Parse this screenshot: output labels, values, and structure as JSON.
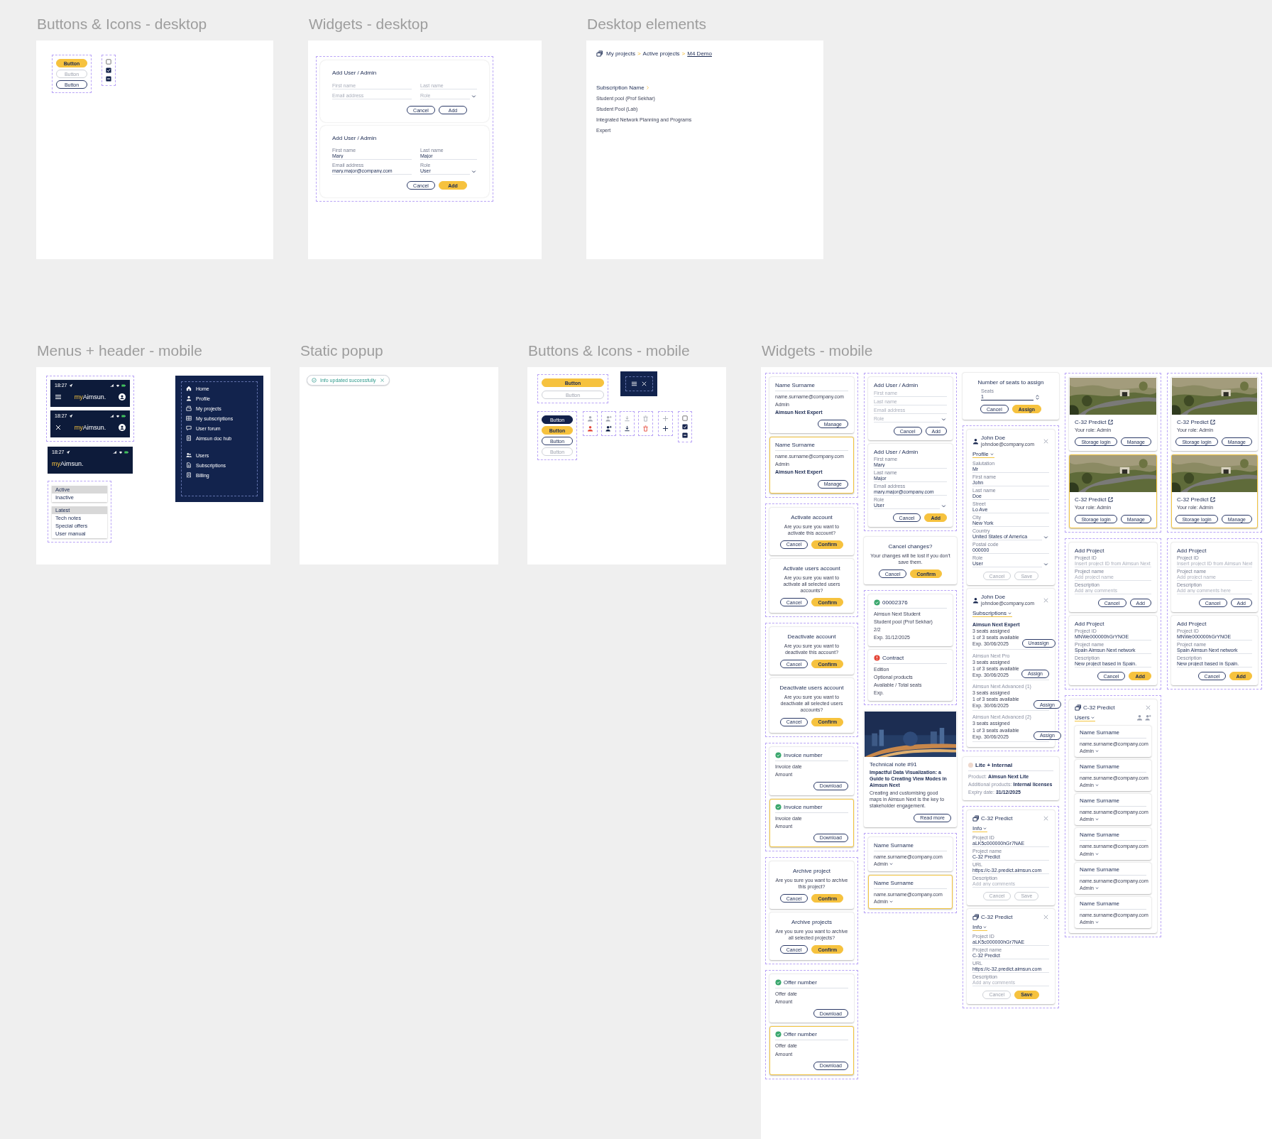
{
  "frames": [
    {
      "title": "Buttons & Icons - desktop",
      "groups": [
        {
          "kind": "buttons",
          "outlined": true,
          "items": [
            {
              "label": "Button",
              "kind": "primary"
            },
            {
              "label": "Button",
              "kind": "disabled"
            },
            {
              "label": "Button",
              "kind": "outline"
            }
          ]
        },
        {
          "kind": "checkboxes",
          "outlined": true,
          "items": [
            {
              "checked": false,
              "mixed": false
            },
            {
              "checked": true,
              "mixed": false
            },
            {
              "checked": true,
              "mixed": true
            }
          ]
        }
      ]
    },
    {
      "title": "Widgets - desktop",
      "groups": [
        {
          "kind": "cards",
          "outlined": true,
          "cards": [
            {
              "kind": "form",
              "title": "Add User / Admin",
              "fields": [
                {
                  "placeholder": "First name"
                },
                {
                  "placeholder": "Last name"
                },
                {
                  "placeholder": "Email address"
                },
                {
                  "placeholder": "Role",
                  "dropdown": true
                }
              ],
              "buttons": [
                {
                  "label": "Cancel",
                  "kind": "outline"
                },
                {
                  "label": "Add",
                  "kind": "outline"
                }
              ]
            },
            {
              "kind": "form",
              "title": "Add User / Admin",
              "fields": [
                {
                  "label": "First name",
                  "value": "Mary"
                },
                {
                  "label": "Last name",
                  "value": "Major"
                },
                {
                  "label": "Email address",
                  "value": "mary.major@company.com"
                },
                {
                  "label": "Role",
                  "value": "User",
                  "dropdown": true
                }
              ],
              "buttons": [
                {
                  "label": "Cancel",
                  "kind": "outline"
                },
                {
                  "label": "Add",
                  "kind": "primary"
                }
              ]
            }
          ]
        }
      ]
    },
    {
      "title": "Desktop elements",
      "groups": [
        {
          "kind": "breadcrumb",
          "items": [
            {
              "label": "My projects",
              "current": false
            },
            {
              "label": "Active projects",
              "current": false
            },
            {
              "label": "M4 Demo",
              "current": true
            }
          ],
          "separators": [
            ">",
            ">"
          ]
        },
        {
          "kind": "sub-list",
          "title": "Subscription Name",
          "items": [
            "Student pool (Prof Sekhar)",
            "Student Pool (Lab)",
            "Integrated Network Planning and Programs",
            "Expert"
          ]
        }
      ]
    },
    {
      "title": "Menus + header - mobile",
      "groups": [
        {
          "kind": "headers",
          "outlined": true,
          "headers": [
            {
              "time": "18:27",
              "logo_prefix": "my",
              "logo_name": "Aimsun."
            },
            {
              "time": "18:27",
              "logo_prefix": "my",
              "logo_name": "Aimsun."
            }
          ]
        },
        {
          "kind": "headers",
          "outlined": false,
          "headers": [
            {
              "time": "18:27",
              "logo_prefix": "my",
              "logo_name": "Aimsun."
            }
          ]
        },
        {
          "kind": "side-menu",
          "sections": [
            {
              "items": [
                "Home",
                "Profile",
                "My projects",
                "My subscriptions",
                "User forum",
                "Aimsun doc hub"
              ]
            },
            {
              "items": [
                "Users",
                "Subscriptions",
                "Billing"
              ]
            }
          ]
        },
        {
          "kind": "list-menu",
          "outlined": true,
          "sections": [
            {
              "items": [
                {
                  "label": "Active",
                  "selected": true
                },
                {
                  "label": "Inactive",
                  "selected": false
                }
              ]
            },
            {
              "items": [
                {
                  "label": "Latest",
                  "selected": true
                },
                {
                  "label": "Tech notes",
                  "selected": false
                },
                {
                  "label": "Special offers",
                  "selected": false
                },
                {
                  "label": "User manual",
                  "selected": false
                }
              ]
            }
          ]
        }
      ]
    },
    {
      "title": "Static popup",
      "groups": [
        {
          "kind": "toast",
          "text": "Info updated successfully"
        }
      ]
    },
    {
      "title": "Buttons & Icons - mobile",
      "groups": [
        {
          "kind": "buttons",
          "outlined": true,
          "items": [
            {
              "label": "Button",
              "kind": "primary"
            },
            {
              "label": "Button",
              "kind": "disabled"
            }
          ]
        },
        {
          "kind": "menu-toggle"
        },
        {
          "kind": "buttons",
          "outlined": true,
          "items": [
            {
              "label": "Button",
              "kind": "dark"
            },
            {
              "label": "Button",
              "kind": "primary"
            },
            {
              "label": "Button",
              "kind": "outline"
            },
            {
              "label": "Button",
              "kind": "disabled"
            }
          ]
        },
        {
          "kind": "icon-pair",
          "outlined": true,
          "icons": [
            {
              "active": false
            },
            {
              "active": true
            }
          ]
        },
        {
          "kind": "icon-pair",
          "outlined": true,
          "icons": [
            {
              "active": false
            },
            {
              "active": true
            }
          ]
        },
        {
          "kind": "icon-pair",
          "outlined": true,
          "icons": [
            {
              "active": false
            },
            {
              "active": true
            }
          ]
        },
        {
          "kind": "icon-pair",
          "outlined": true,
          "icons": [
            {
              "active": false
            },
            {
              "active": true
            }
          ]
        },
        {
          "kind": "icon-pair",
          "outlined": true,
          "icons": [
            {
              "active": false
            },
            {
              "active": true
            }
          ]
        },
        {
          "kind": "checkboxes",
          "outlined": true,
          "items": [
            {
              "checked": false,
              "mixed": false
            },
            {
              "checked": true,
              "mixed": false
            },
            {
              "checked": true,
              "mixed": true
            }
          ]
        }
      ]
    },
    {
      "title": "Widgets - mobile",
      "groups": [
        {
          "kind": "cards",
          "outlined": true,
          "cards": [
            {
              "kind": "contact",
              "selected": false,
              "name": "Name Surname",
              "email": "name.surname@company.com",
              "role": "Admin",
              "product": "Aimsun Next Expert",
              "button": {
                "label": "Manage",
                "kind": "outline"
              }
            },
            {
              "kind": "contact",
              "selected": true,
              "name": "Name Surname",
              "email": "name.surname@company.com",
              "role": "Admin",
              "product": "Aimsun Next Expert",
              "button": {
                "label": "Manage",
                "kind": "outline"
              }
            }
          ]
        },
        {
          "kind": "cards",
          "outlined": true,
          "cards": [
            {
              "kind": "confirm",
              "title": "Activate account",
              "message": "Are you sure you want to activate this account?",
              "buttons": [
                {
                  "label": "Cancel",
                  "kind": "outline"
                },
                {
                  "label": "Confirm",
                  "kind": "primary"
                }
              ]
            },
            {
              "kind": "confirm",
              "title": "Activate users account",
              "message": "Are you sure you want to activate all selected users accounts?",
              "buttons": [
                {
                  "label": "Cancel",
                  "kind": "outline"
                },
                {
                  "label": "Confirm",
                  "kind": "primary"
                }
              ]
            }
          ]
        },
        {
          "kind": "cards",
          "outlined": true,
          "cards": [
            {
              "kind": "confirm",
              "title": "Deactivate account",
              "message": "Are you sure you want to deactivate this account?",
              "buttons": [
                {
                  "label": "Cancel",
                  "kind": "outline"
                },
                {
                  "label": "Confirm",
                  "kind": "primary"
                }
              ]
            },
            {
              "kind": "confirm",
              "title": "Deactivate users account",
              "message": "Are you sure you want to deactivate all selected users accounts?",
              "buttons": [
                {
                  "label": "Cancel",
                  "kind": "outline"
                },
                {
                  "label": "Confirm",
                  "kind": "primary"
                }
              ]
            }
          ]
        },
        {
          "kind": "cards",
          "outlined": true,
          "cards": [
            {
              "kind": "doc",
              "selected": false,
              "alert": false,
              "title": "Invoice number",
              "lines": [
                "Invoice date",
                "Amount"
              ],
              "button": {
                "label": "Download",
                "kind": "outline"
              }
            },
            {
              "kind": "doc",
              "selected": true,
              "alert": false,
              "title": "Invoice number",
              "lines": [
                "Invoice date",
                "Amount"
              ],
              "button": {
                "label": "Download",
                "kind": "outline"
              }
            }
          ]
        },
        {
          "kind": "cards",
          "outlined": true,
          "cards": [
            {
              "kind": "confirm",
              "title": "Archive project",
              "message": "Are you sure you want to archive this project?",
              "buttons": [
                {
                  "label": "Cancel",
                  "kind": "outline"
                },
                {
                  "label": "Confirm",
                  "kind": "primary"
                }
              ]
            },
            {
              "kind": "confirm",
              "title": "Archive projects",
              "message": "Are you sure you want to archive all selected projects?",
              "buttons": [
                {
                  "label": "Cancel",
                  "kind": "outline"
                },
                {
                  "label": "Confirm",
                  "kind": "primary"
                }
              ]
            }
          ]
        },
        {
          "kind": "cards",
          "outlined": true,
          "cards": [
            {
              "kind": "doc",
              "selected": false,
              "alert": false,
              "title": "Offer number",
              "lines": [
                "Offer date",
                "Amount"
              ],
              "button": {
                "label": "Download",
                "kind": "outline"
              }
            },
            {
              "kind": "doc",
              "selected": true,
              "alert": false,
              "title": "Offer number",
              "lines": [
                "Offer date",
                "Amount"
              ],
              "button": {
                "label": "Download",
                "kind": "outline"
              }
            }
          ]
        },
        {
          "kind": "cards",
          "outlined": true,
          "cards": [
            {
              "kind": "form",
              "title": "Add User / Admin",
              "fields": [
                {
                  "placeholder": "First name"
                },
                {
                  "placeholder": "Last name"
                },
                {
                  "placeholder": "Email address"
                },
                {
                  "placeholder": "Role",
                  "dropdown": true
                }
              ],
              "buttons": [
                {
                  "label": "Cancel",
                  "kind": "outline"
                },
                {
                  "label": "Add",
                  "kind": "outline"
                }
              ]
            },
            {
              "kind": "form",
              "title": "Add User / Admin",
              "fields": [
                {
                  "label": "First name",
                  "value": "Mary"
                },
                {
                  "label": "Last name",
                  "value": "Major"
                },
                {
                  "label": "Email address",
                  "value": "mary.major@company.com"
                },
                {
                  "label": "Role",
                  "value": "User",
                  "dropdown": true
                }
              ],
              "buttons": [
                {
                  "label": "Cancel",
                  "kind": "outline"
                },
                {
                  "label": "Add",
                  "kind": "primary"
                }
              ]
            }
          ]
        },
        {
          "kind": "cards",
          "outlined": false,
          "cards": [
            {
              "kind": "confirm",
              "title": "Cancel changes?",
              "message": "Your changes will be lost if you don't save them.",
              "buttons": [
                {
                  "label": "Cancel",
                  "kind": "outline"
                },
                {
                  "label": "Confirm",
                  "kind": "primary"
                }
              ]
            }
          ]
        },
        {
          "kind": "cards",
          "outlined": true,
          "cards": [
            {
              "kind": "doc",
              "alert": false,
              "title": "00002376",
              "lines": [
                "Aimsun Next Student",
                "Student pool (Prof Sekhar)",
                "2/2",
                "Exp. 31/12/2025"
              ]
            },
            {
              "kind": "doc",
              "alert": true,
              "title": "Contract",
              "lines": [
                "Edition",
                "Optional products",
                "Available / Total seats",
                "Exp."
              ]
            }
          ]
        },
        {
          "kind": "cards",
          "outlined": false,
          "cards": [
            {
              "kind": "note",
              "label": "Technical note #91",
              "headline": "Impactful Data Visualization: a Guide to Creating View Modes in Aimsun Next",
              "body": "Creating and customising good maps in Aimsun Next is the key to stakeholder engagement.",
              "button": {
                "label": "Read more",
                "kind": "outline"
              }
            }
          ]
        },
        {
          "kind": "cards",
          "outlined": true,
          "cards": [
            {
              "kind": "user",
              "selected": false,
              "name": "Name Surname",
              "email": "name.surname@company.com",
              "role": "Admin"
            },
            {
              "kind": "user",
              "selected": true,
              "name": "Name Surname",
              "email": "name.surname@company.com",
              "role": "Admin"
            }
          ]
        },
        {
          "kind": "cards",
          "outlined": false,
          "cards": [
            {
              "kind": "seats",
              "title": "Number of seats to assign",
              "label": "Seats",
              "value": "1",
              "buttons": [
                {
                  "label": "Cancel",
                  "kind": "outline"
                },
                {
                  "label": "Assign",
                  "kind": "primary"
                }
              ]
            }
          ]
        },
        {
          "kind": "cards",
          "outlined": true,
          "cards": [
            {
              "kind": "profile",
              "name": "John Doe",
              "email": "johndoe@company.com",
              "tab": "Profile",
              "fields": [
                {
                  "label": "Salutation",
                  "value": "Mr"
                },
                {
                  "label": "First name",
                  "value": "John"
                },
                {
                  "label": "Last name",
                  "value": "Doe"
                },
                {
                  "label": "Street",
                  "value": "Lo Ave"
                },
                {
                  "label": "City",
                  "value": "New York"
                },
                {
                  "label": "Country",
                  "value": "United States of America",
                  "dropdown": true
                },
                {
                  "label": "Postal code",
                  "value": "000000"
                },
                {
                  "label": "Role",
                  "value": "User",
                  "dropdown": true
                }
              ],
              "buttons": [
                {
                  "label": "Cancel",
                  "kind": "disabled"
                },
                {
                  "label": "Save",
                  "kind": "disabled"
                }
              ]
            },
            {
              "kind": "profile",
              "name": "John Doe",
              "email": "johndoe@company.com",
              "tab": "Subscriptions",
              "entries": [
                {
                  "title": "Aimsun Next Expert",
                  "active": true,
                  "lines": [
                    "3 seats assigned",
                    "1 of 3 seats available",
                    "Exp. 30/06/2025"
                  ],
                  "button": {
                    "label": "Unassign",
                    "kind": "outline"
                  }
                },
                {
                  "title": "Aimsun Next Pro",
                  "active": false,
                  "lines": [
                    "3 seats assigned",
                    "1 of 3 seats available",
                    "Exp. 30/06/2025"
                  ],
                  "button": {
                    "label": "Assign",
                    "kind": "outline"
                  }
                },
                {
                  "title": "Aimsun Next Advanced (1)",
                  "active": false,
                  "lines": [
                    "3 seats assigned",
                    "1 of 3 seats available",
                    "Exp. 30/06/2025"
                  ],
                  "button": {
                    "label": "Assign",
                    "kind": "outline"
                  }
                },
                {
                  "title": "Aimsun Next Advanced (2)",
                  "active": false,
                  "lines": [
                    "3 seats assigned",
                    "1 of 3 seats available",
                    "Exp. 30/06/2025"
                  ],
                  "button": {
                    "label": "Assign",
                    "kind": "outline"
                  }
                }
              ]
            }
          ]
        },
        {
          "kind": "cards",
          "outlined": false,
          "cards": [
            {
              "kind": "info",
              "color": "#eed8cc",
              "title": "Lite + Internal",
              "rows": [
                {
                  "label": "Product:",
                  "value": "Aimsun Next Lite"
                },
                {
                  "label": "Additional products:",
                  "value": "Internal licenses"
                },
                {
                  "label": "Expiry date:",
                  "value": "31/12/2025"
                }
              ]
            }
          ]
        },
        {
          "kind": "cards",
          "outlined": true,
          "cards": [
            {
              "kind": "project",
              "title": "C-32 Predict",
              "tab": "Info",
              "fields": [
                {
                  "label": "Project ID",
                  "value": "aLK5c000000hGr7NAE"
                },
                {
                  "label": "Project name",
                  "value": "C-32 Predict"
                },
                {
                  "label": "URL",
                  "value": "https://c-32.predict.aimsun.com"
                },
                {
                  "label": "Description",
                  "placeholder": "Add any comments"
                }
              ],
              "buttons": [
                {
                  "label": "Cancel",
                  "kind": "disabled"
                },
                {
                  "label": "Save",
                  "kind": "disabled"
                }
              ]
            },
            {
              "kind": "project",
              "title": "C-32 Predict",
              "tab": "Info",
              "fields": [
                {
                  "label": "Project ID",
                  "value": "aLK5c000000hGr7NAE"
                },
                {
                  "label": "Project name",
                  "value": "C-32 Predict"
                },
                {
                  "label": "URL",
                  "value": "https://c-32.predict.aimsun.com"
                },
                {
                  "label": "Description",
                  "placeholder": "Add any comments"
                }
              ],
              "buttons": [
                {
                  "label": "Cancel",
                  "kind": "disabled"
                },
                {
                  "label": "Save",
                  "kind": "primary"
                }
              ]
            }
          ]
        },
        {
          "kind": "cards",
          "outlined": true,
          "cards": [
            {
              "selected": false,
              "title": "C-32 Predict",
              "role": "Your role: Admin",
              "buttons": [
                {
                  "label": "Storage login",
                  "kind": "outline"
                },
                {
                  "label": "Manage",
                  "kind": "outline"
                }
              ]
            },
            {
              "selected": true,
              "title": "C-32 Predict",
              "role": "Your role: Admin",
              "buttons": [
                {
                  "label": "Storage login",
                  "kind": "outline"
                },
                {
                  "label": "Manage",
                  "kind": "outline"
                }
              ]
            }
          ]
        },
        {
          "kind": "cards",
          "outlined": true,
          "cards": [
            {
              "selected": false,
              "title": "C-32 Predict",
              "role": "Your role: Admin",
              "buttons": [
                {
                  "label": "Storage login",
                  "kind": "outline"
                },
                {
                  "label": "Manage",
                  "kind": "outline"
                }
              ]
            },
            {
              "selected": true,
              "title": "C-32 Predict",
              "role": "Your role: Admin",
              "buttons": [
                {
                  "label": "Storage login",
                  "kind": "outline"
                },
                {
                  "label": "Manage",
                  "kind": "outline"
                }
              ]
            }
          ]
        },
        {
          "kind": "cards",
          "outlined": true,
          "cards": [
            {
              "kind": "form",
              "title": "Add Project",
              "fields": [
                {
                  "label": "Project ID",
                  "placeholder": "Insert project ID from Aimsun Next"
                },
                {
                  "label": "Project name",
                  "placeholder": "Add project name"
                },
                {
                  "label": "Description",
                  "placeholder": "Add any comments"
                }
              ],
              "buttons": [
                {
                  "label": "Cancel",
                  "kind": "outline"
                },
                {
                  "label": "Add",
                  "kind": "outline"
                }
              ]
            },
            {
              "kind": "form",
              "title": "Add Project",
              "fields": [
                {
                  "label": "Project ID",
                  "value": "MNWe000000hGrYNOE"
                },
                {
                  "label": "Project name",
                  "value": "Spain Aimsun Next network"
                },
                {
                  "label": "Description",
                  "value": "New project based in Spain."
                }
              ],
              "buttons": [
                {
                  "label": "Cancel",
                  "kind": "outline"
                },
                {
                  "label": "Add",
                  "kind": "primary"
                }
              ]
            }
          ]
        },
        {
          "kind": "cards",
          "outlined": true,
          "cards": [
            {
              "kind": "form",
              "title": "Add Project",
              "fields": [
                {
                  "label": "Project ID",
                  "placeholder": "Insert project ID from Aimsun Next"
                },
                {
                  "label": "Project name",
                  "placeholder": "Add project name"
                },
                {
                  "label": "Description",
                  "placeholder": "Add any comments here"
                }
              ],
              "buttons": [
                {
                  "label": "Cancel",
                  "kind": "outline"
                },
                {
                  "label": "Add",
                  "kind": "outline"
                }
              ]
            },
            {
              "kind": "form",
              "title": "Add Project",
              "fields": [
                {
                  "label": "Project ID",
                  "value": "MNWe000000hGrYNOE"
                },
                {
                  "label": "Project name",
                  "value": "Spain Aimsun Next network"
                },
                {
                  "label": "Description",
                  "value": "New project based in Spain."
                }
              ],
              "buttons": [
                {
                  "label": "Cancel",
                  "kind": "outline"
                },
                {
                  "label": "Add",
                  "kind": "primary"
                }
              ]
            }
          ]
        },
        {
          "kind": "cards",
          "outlined": true,
          "cards": [
            {
              "kind": "project",
              "title": "C-32 Predict",
              "tab": "Users",
              "users": [
                {
                  "name": "Name Surname",
                  "email": "name.surname@company.com",
                  "role": "Admin"
                },
                {
                  "name": "Name Surname",
                  "email": "name.surname@company.com",
                  "role": "Admin"
                },
                {
                  "name": "Name Surname",
                  "email": "name.surname@company.com",
                  "role": "Admin"
                },
                {
                  "name": "Name Surname",
                  "email": "name.surname@company.com",
                  "role": "Admin"
                },
                {
                  "name": "Name Surname",
                  "email": "name.surname@company.com",
                  "role": "Admin"
                },
                {
                  "name": "Name Surname",
                  "email": "name.surname@company.com",
                  "role": "Admin"
                }
              ]
            }
          ]
        }
      ]
    }
  ]
}
